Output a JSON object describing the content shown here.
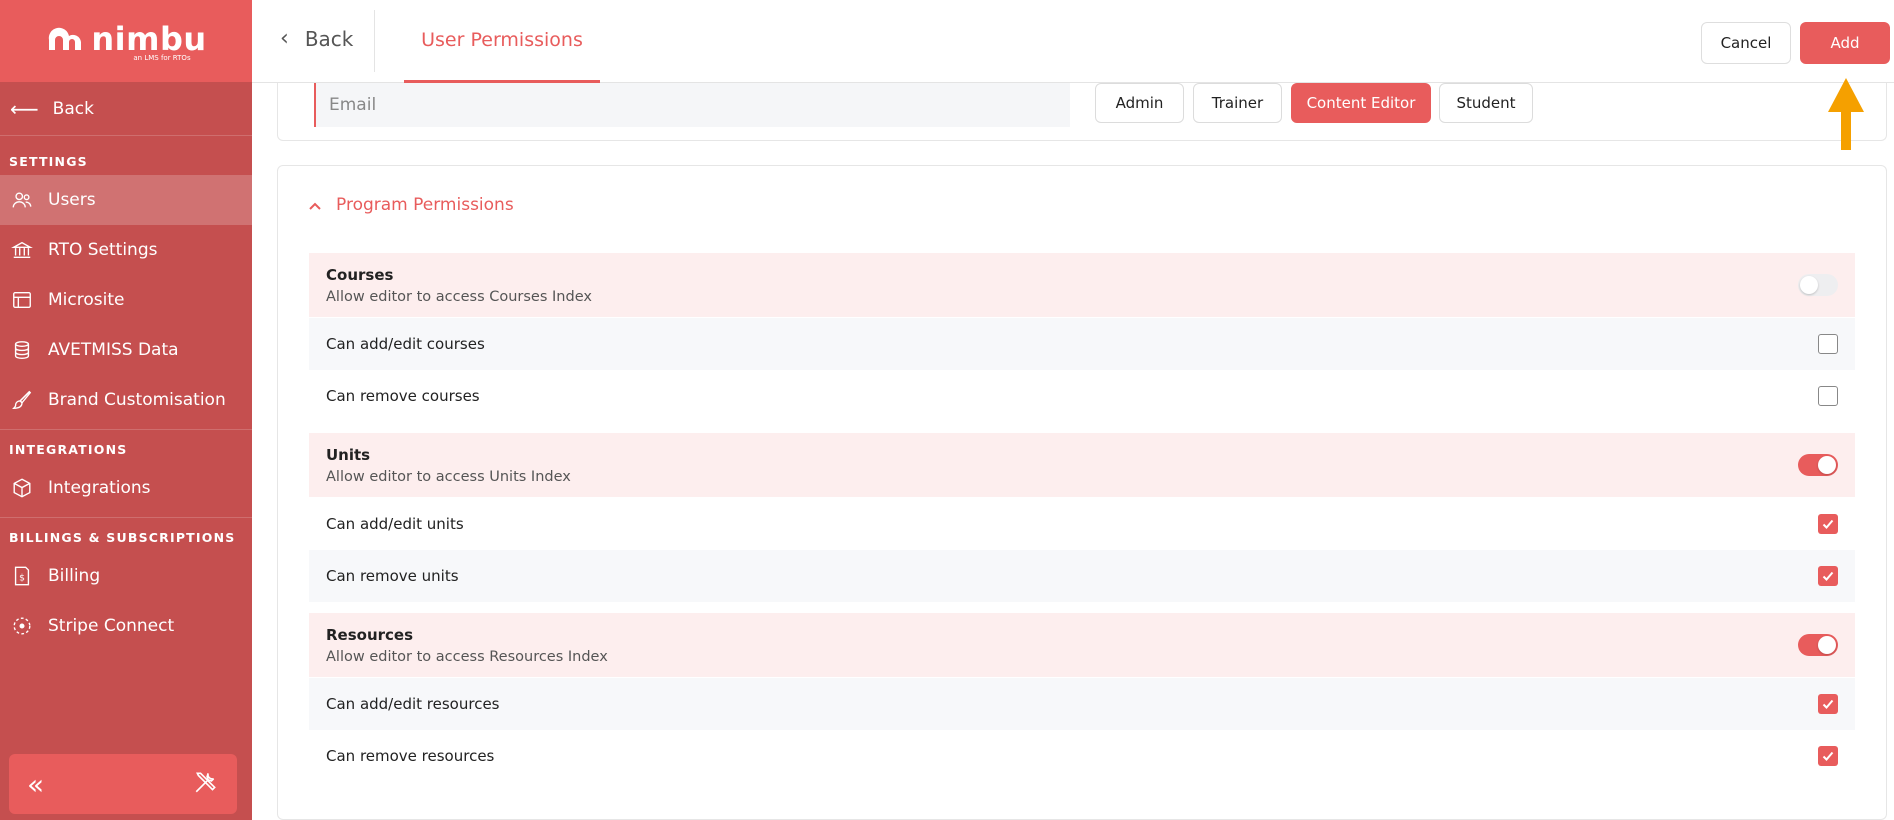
{
  "colors": {
    "brand": "#e85c5c",
    "sidebar": "#c54f4f",
    "row_highlight": "#fdeeee",
    "annotation_arrow": "#f5a000"
  },
  "logo": {
    "name": "nimbu",
    "tagline": "an LMS for RTOs"
  },
  "sidebar": {
    "back_label": "Back",
    "sections": [
      {
        "heading": "SETTINGS",
        "items": [
          {
            "label": "Users",
            "icon": "users-icon",
            "active": true
          },
          {
            "label": "RTO Settings",
            "icon": "bank-icon"
          },
          {
            "label": "Microsite",
            "icon": "browser-icon"
          },
          {
            "label": "AVETMISS Data",
            "icon": "database-icon"
          },
          {
            "label": "Brand Customisation",
            "icon": "brush-icon"
          }
        ]
      },
      {
        "heading": "INTEGRATIONS",
        "items": [
          {
            "label": "Integrations",
            "icon": "cube-icon"
          }
        ]
      },
      {
        "heading": "BILLINGS & SUBSCRIPTIONS",
        "items": [
          {
            "label": "Billing",
            "icon": "invoice-icon"
          },
          {
            "label": "Stripe Connect",
            "icon": "connect-icon"
          }
        ]
      }
    ],
    "collapse_icon": "double-chevron-left-icon",
    "tools_icon": "tools-icon"
  },
  "topbar": {
    "back_label": "Back",
    "active_tab": "User Permissions",
    "cancel_label": "Cancel",
    "add_label": "Add"
  },
  "user_form": {
    "email_placeholder": "Email",
    "roles": [
      {
        "label": "Admin",
        "selected": false
      },
      {
        "label": "Trainer",
        "selected": false
      },
      {
        "label": "Content Editor",
        "selected": true
      },
      {
        "label": "Student",
        "selected": false
      }
    ]
  },
  "program_permissions": {
    "title": "Program Permissions",
    "groups": [
      {
        "title": "Courses",
        "description": "Allow editor to access Courses Index",
        "enabled": false,
        "items": [
          {
            "label": "Can add/edit courses",
            "checked": false
          },
          {
            "label": "Can remove courses",
            "checked": false
          }
        ]
      },
      {
        "title": "Units",
        "description": "Allow editor to access Units Index",
        "enabled": true,
        "items": [
          {
            "label": "Can add/edit units",
            "checked": true
          },
          {
            "label": "Can remove units",
            "checked": true
          }
        ]
      },
      {
        "title": "Resources",
        "description": "Allow editor to access Resources Index",
        "enabled": true,
        "items": [
          {
            "label": "Can add/edit resources",
            "checked": true
          },
          {
            "label": "Can remove resources",
            "checked": true
          }
        ]
      }
    ]
  }
}
